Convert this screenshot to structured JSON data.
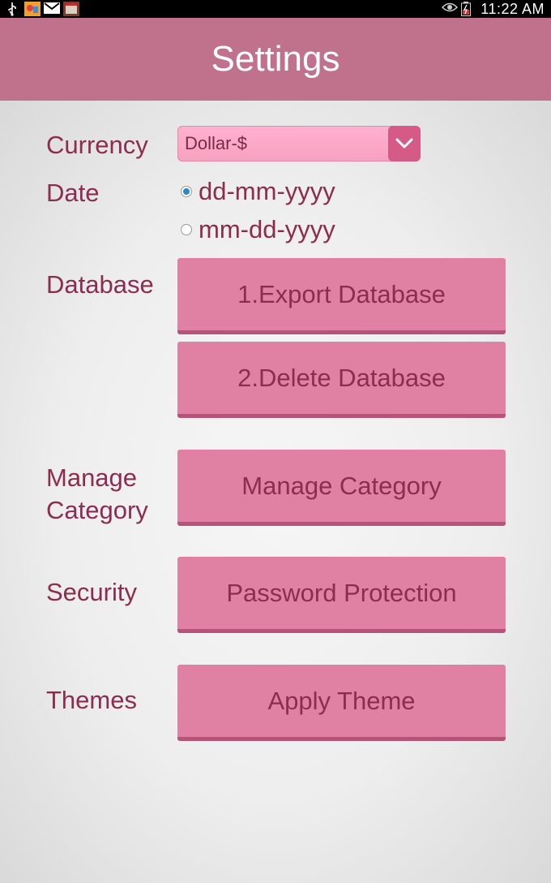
{
  "status_bar": {
    "left_icons": [
      "usb-icon",
      "app-notification-icon",
      "gmail-icon",
      "calendar-app-icon"
    ],
    "right_icons": [
      "eye-icon",
      "battery-charging-icon"
    ],
    "time": "11:22 AM"
  },
  "header": {
    "title": "Settings"
  },
  "settings": {
    "currency": {
      "label": "Currency",
      "selected": "Dollar-$"
    },
    "date": {
      "label": "Date",
      "options": [
        {
          "label": "dd-mm-yyyy",
          "checked": true
        },
        {
          "label": "mm-dd-yyyy",
          "checked": false
        }
      ]
    },
    "database": {
      "label": "Database",
      "export_button": "1.Export Database",
      "delete_button": "2.Delete Database"
    },
    "manage_category": {
      "label_line1": "Manage",
      "label_line2": "Category",
      "button": "Manage Category"
    },
    "security": {
      "label": "Security",
      "button": "Password Protection"
    },
    "themes": {
      "label": "Themes",
      "button": "Apply Theme"
    }
  },
  "colors": {
    "header": "#c0718c",
    "button": "#e080a2",
    "text": "#8c2d4f",
    "dropdown_arrow": "#d55a85"
  }
}
